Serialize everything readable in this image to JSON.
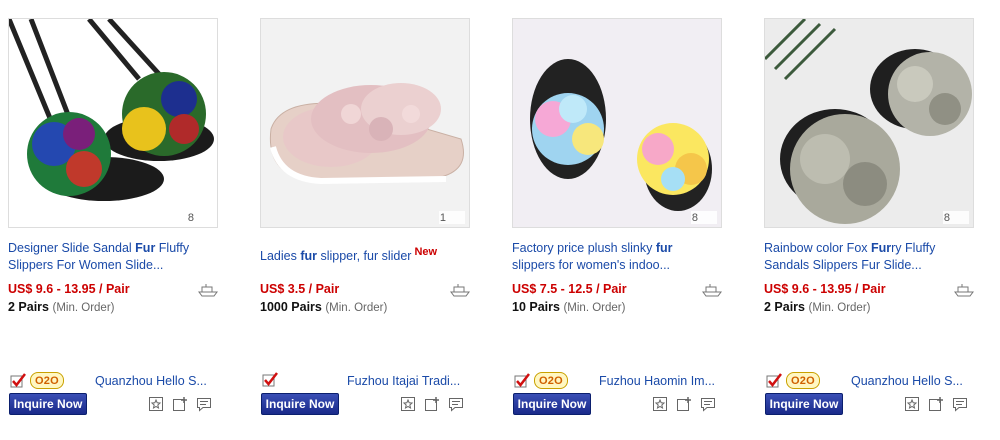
{
  "common": {
    "min_order_note": "(Min. Order)",
    "inquire_label": "Inquire Now",
    "o2o_label": "O2O"
  },
  "products": [
    {
      "title_parts": [
        "Designer Slide Sandal ",
        "Fur",
        " Fluffy Slippers For Women Slide..."
      ],
      "is_new": false,
      "image_count": "8",
      "price": "US$ 9.6 - 13.95 / Pair",
      "moq": "2 Pairs",
      "has_o2o": true,
      "supplier": "Quanzhou Hello S..."
    },
    {
      "title_parts": [
        "Ladies ",
        "fur",
        " slipper, fur slider"
      ],
      "is_new": true,
      "new_label": "New",
      "image_count": "1",
      "price": "US$ 3.5 / Pair",
      "moq": "1000 Pairs",
      "has_o2o": false,
      "supplier": "Fuzhou Itajai Tradi..."
    },
    {
      "title_parts": [
        "Factory price plush slinky ",
        "fur",
        " slippers for women's indoo..."
      ],
      "is_new": false,
      "image_count": "8",
      "price": "US$ 7.5 - 12.5 / Pair",
      "moq": "10 Pairs",
      "has_o2o": true,
      "supplier": "Fuzhou Haomin Im..."
    },
    {
      "title_parts": [
        "Rainbow color Fox ",
        "Fur",
        "ry Fluffy Sandals Slippers Fur Slide..."
      ],
      "is_new": false,
      "image_count": "8",
      "price": "US$ 9.6 - 13.95 / Pair",
      "moq": "2 Pairs",
      "has_o2o": true,
      "supplier": "Quanzhou Hello S..."
    }
  ],
  "colors": {
    "link": "#1a4aa8",
    "price": "#cc0000",
    "button": "#1a2a8a"
  }
}
